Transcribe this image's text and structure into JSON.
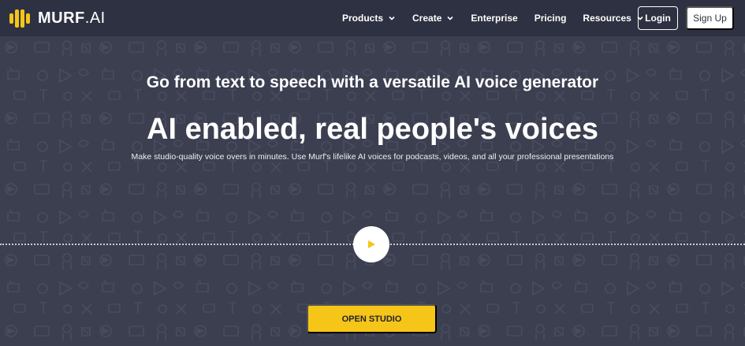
{
  "brand": {
    "name_bold": "MURF",
    "name_light": ".AI"
  },
  "nav": {
    "items": [
      {
        "label": "Products",
        "dropdown": true
      },
      {
        "label": "Create",
        "dropdown": true
      },
      {
        "label": "Enterprise",
        "dropdown": false
      },
      {
        "label": "Pricing",
        "dropdown": false
      },
      {
        "label": "Resources",
        "dropdown": true
      }
    ],
    "login_label": "Login",
    "signup_label": "Sign Up"
  },
  "hero": {
    "subtitle": "Go from text to speech with a versatile AI voice generator",
    "headline": "AI enabled, real people's voices",
    "description": "Make studio-quality voice overs in minutes. Use Murf's lifelike AI voices for podcasts, videos, and all your professional presentations",
    "play_icon": "play-icon",
    "cta_label": "OPEN STUDIO"
  },
  "colors": {
    "accent": "#f5c518",
    "navbar_bg": "#2e3141",
    "hero_bg": "#3b3f50",
    "pattern_icon": "#484c5e"
  }
}
